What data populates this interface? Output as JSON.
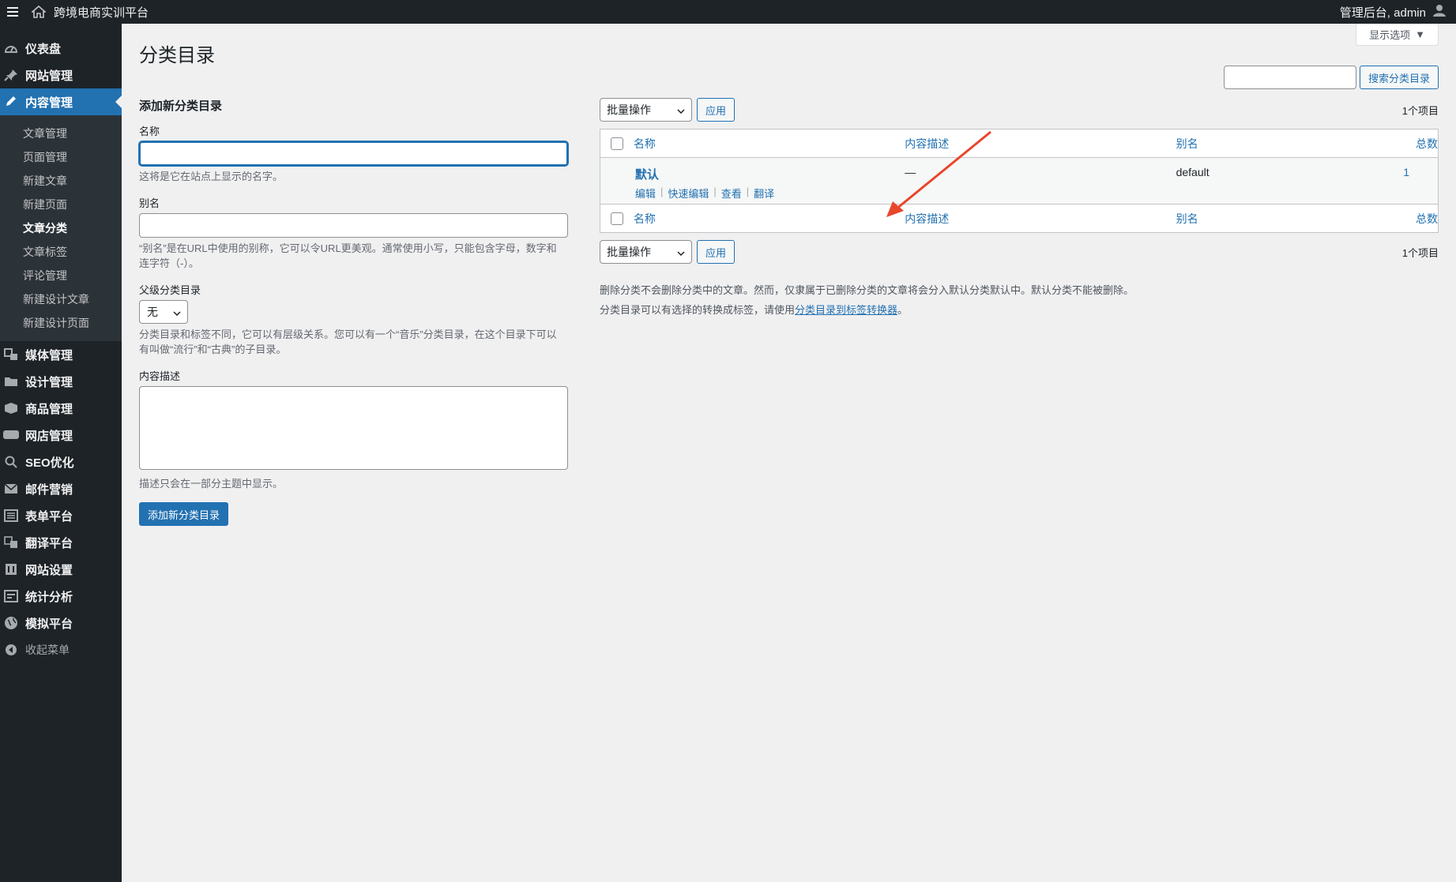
{
  "adminbar": {
    "site_name": "跨境电商实训平台",
    "account": "管理后台, admin"
  },
  "sidebar": {
    "top_items": [
      {
        "label": "仪表盘",
        "icon": "dashboard-icon"
      },
      {
        "label": "网站管理",
        "icon": "pin-icon"
      },
      {
        "label": "内容管理",
        "icon": "pencil-icon"
      }
    ],
    "submenu": [
      "文章管理",
      "页面管理",
      "新建文章",
      "新建页面",
      "文章分类",
      "文章标签",
      "评论管理",
      "新建设计文章",
      "新建设计页面"
    ],
    "bottom_items": [
      {
        "label": "媒体管理",
        "icon": "media-icon"
      },
      {
        "label": "设计管理",
        "icon": "folder-icon"
      },
      {
        "label": "商品管理",
        "icon": "box-icon"
      },
      {
        "label": "网店管理",
        "icon": "woo-icon"
      },
      {
        "label": "SEO优化",
        "icon": "search-icon"
      },
      {
        "label": "邮件营销",
        "icon": "mail-icon"
      },
      {
        "label": "表单平台",
        "icon": "form-icon"
      },
      {
        "label": "翻译平台",
        "icon": "translate-icon"
      },
      {
        "label": "网站设置",
        "icon": "settings-icon"
      },
      {
        "label": "统计分析",
        "icon": "stats-icon"
      },
      {
        "label": "模拟平台",
        "icon": "globe-icon"
      }
    ],
    "collapse": "收起菜单"
  },
  "screen_options": "显示选项",
  "page_title": "分类目录",
  "search": {
    "button": "搜索分类目录",
    "value": ""
  },
  "form": {
    "heading": "添加新分类目录",
    "name_label": "名称",
    "name_help": "这将是它在站点上显示的名字。",
    "slug_label": "别名",
    "slug_help_1": "“别名”是在URL中使用的别称，它可以令URL更美观。通常使用小写，只能包含字母，数字和",
    "slug_help_2": "连字符（-）。",
    "parent_label": "父级分类目录",
    "parent_value": "无",
    "parent_help_1": "分类目录和标签不同，它可以有层级关系。您可以有一个“音乐”分类目录，在这个目录下可以",
    "parent_help_2": "有叫做“流行”和“古典”的子目录。",
    "desc_label": "内容描述",
    "desc_help": "描述只会在一部分主题中显示。",
    "submit": "添加新分类目录"
  },
  "table": {
    "bulk_label": "批量操作",
    "apply": "应用",
    "count": "1个项目",
    "columns": {
      "name": "名称",
      "desc": "内容描述",
      "slug": "别名",
      "count": "总数"
    },
    "rows": [
      {
        "name": "默认",
        "desc": "—",
        "slug": "default",
        "count": "1",
        "actions": [
          "编辑",
          "快速编辑",
          "查看",
          "翻译"
        ]
      }
    ]
  },
  "notes": {
    "line1": "删除分类不会删除分类中的文章。然而，仅隶属于已删除分类的文章将会分入默认分类默认中。默认分类不能被删除。",
    "line2_prefix": "分类目录可以有选择的转换成标签，请使用",
    "line2_link": "分类目录到标签转换器",
    "line2_suffix": "。"
  },
  "colors": {
    "accent": "#2271b1",
    "sidebar_bg": "#1d2327",
    "arrow": "#e8462a"
  }
}
